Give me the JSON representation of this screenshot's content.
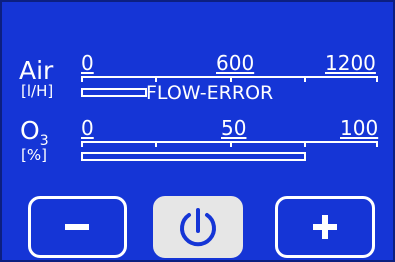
{
  "air": {
    "label": "Air",
    "unit": "[l/H]",
    "scale": [
      "0",
      "600",
      "1200"
    ],
    "status_text": "FLOW-ERROR",
    "level": 0
  },
  "o3": {
    "label": "O",
    "label_sub": "3",
    "unit": "[%]",
    "scale": [
      "0",
      "50",
      "100"
    ],
    "level": 0
  },
  "buttons": {
    "decrease_icon": "minus-icon",
    "power_icon": "power-icon",
    "increase_icon": "plus-icon"
  },
  "colors": {
    "background": "#1535d6",
    "foreground": "#ffffff",
    "power_button": "#e6e6e6",
    "power_symbol": "#1535d6"
  }
}
